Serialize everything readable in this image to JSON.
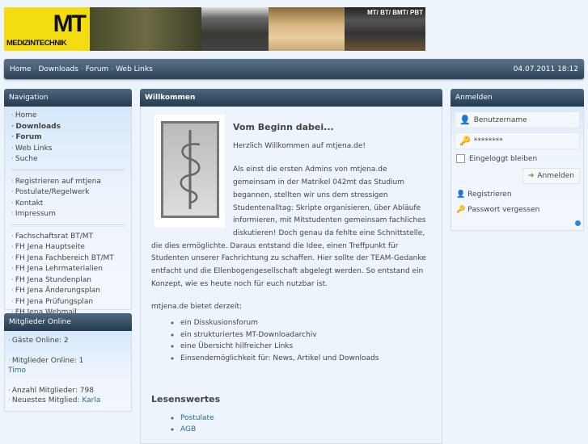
{
  "banner": {
    "logo_big": "MT",
    "logo_small": "MEDIZINTECHNIK",
    "tagline": "MT/ BT/ BMT/ PBT"
  },
  "topnav": {
    "items": [
      "Home",
      "Downloads",
      "Forum",
      "Web Links"
    ],
    "datetime": "04.07.2011 18:12"
  },
  "navigation": {
    "title": "Navigation",
    "group1": [
      "Home",
      "Downloads",
      "Forum",
      "Web Links",
      "Suche"
    ],
    "group2": [
      "Registrieren auf mtjena",
      "Postulate/Regelwerk",
      "Kontakt",
      "Impressum"
    ],
    "group3": [
      "Fachschaftsrat BT/MT",
      "FH Jena Hauptseite",
      "FH Jena Fachbereich BT/MT",
      "FH Jena Lehrmaterialien",
      "FH Jena Stundenplan",
      "FH Jena Änderungsplan",
      "FH Jena Prüfungsplan",
      "FH Jena Webmail"
    ]
  },
  "members": {
    "title": "Mitglieder Online",
    "guests": "Gäste Online: 2",
    "members_online": "Mitglieder Online: 1",
    "member_name": "Timo",
    "total": "Anzahl Mitglieder: 798",
    "newest_label": "Neuestes Mitglied:",
    "newest_name": "Karla"
  },
  "main": {
    "title": "Willkommen",
    "heading": "Vom Beginn dabei...",
    "greeting": "Herzlich Willkommen auf mtjena.de!",
    "paragraph": "Als einst die ersten Admins von mtjena.de gemeinsam in der Matrikel 042mt das Studium begannen, stellten wir uns dem stressigen Studentenalltag: Skripte organisieren, über Abläufe informieren, mit Mitstudenten gemeinsam fachliches diskutieren! Doch genau da fehlte eine Schnittstelle, die dies ermöglichte. Daraus entstand die Idee, einen Treffpunkt für Studenten unserer Fachrichtung zu schaffen. Hier sollte der TEAM-Gedanke entfacht und die Ellenbogengesellschaft abgelegt werden. So entstand ein Konzept, wie es heute noch für euch nutzbar ist.",
    "offers_intro": "mtjena.de bietet derzeit:",
    "offers": [
      "ein Disskusionsforum",
      "ein strukturiertes MT-Downloadarchiv",
      "eine Übersicht hilfreicher Links",
      "Einsendemöglichkeit für: News, Artikel und Downloads"
    ],
    "reading_title": "Lesenswertes",
    "reading": [
      "Postulate",
      "AGB"
    ]
  },
  "login": {
    "title": "Anmelden",
    "username_placeholder": "Benutzername",
    "password_value": "********",
    "remember": "Eingeloggt bleiben",
    "submit": "Anmelden",
    "register": "Registrieren",
    "forgot": "Passwort vergessen"
  }
}
